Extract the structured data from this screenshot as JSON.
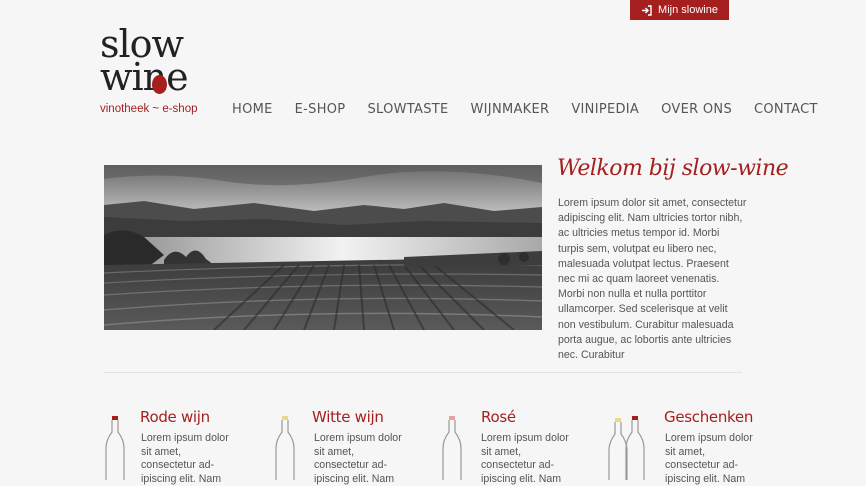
{
  "top_button": {
    "label": "Mijn slowine",
    "icon": "sign-in-icon",
    "color": "#a51f1f"
  },
  "logo": {
    "line1": "slow",
    "line2": "wine",
    "tagline": "vinotheek ~ e-shop"
  },
  "nav": {
    "items": [
      {
        "label": "HOME"
      },
      {
        "label": "E-SHOP"
      },
      {
        "label": "SLOWTASTE"
      },
      {
        "label": "WIJNMAKER"
      },
      {
        "label": "VINIPEDIA"
      },
      {
        "label": "OVER ONS"
      },
      {
        "label": "CONTACT"
      }
    ]
  },
  "welcome": {
    "title": "Welkom bij slow-wine",
    "body": "Lorem ipsum dolor sit amet, consectetur adipiscing elit. Nam ultricies tortor nibh, ac ultricies metus tempor id. Morbi turpis sem, volutpat eu libero nec, malesuada volutpat lectus. Praesent nec mi ac quam laoreet venenatis. Morbi non nulla et nulla porttitor ullamcorper. Sed scelerisque at velit non vestibulum. Curabitur malesuada porta augue, ac lobortis ante ultricies nec. Curabitur"
  },
  "categories": [
    {
      "title": "Rode wijn",
      "text": "Lorem ipsum dolor sit amet, consectetur ad-ipiscing elit. Nam",
      "icon": "red-wine-bottle-icon"
    },
    {
      "title": "Witte wijn",
      "text": "Lorem ipsum dolor sit amet, consectetur ad-ipiscing elit. Nam",
      "icon": "white-wine-bottle-icon"
    },
    {
      "title": "Rosé",
      "text": "Lorem ipsum dolor sit amet, consectetur ad-ipiscing elit. Nam",
      "icon": "rose-wine-bottle-icon"
    },
    {
      "title": "Geschenken",
      "text": "Lorem ipsum dolor sit amet, consectetur ad-ipiscing elit. Nam",
      "icon": "gift-bottles-icon"
    }
  ],
  "colors": {
    "accent": "#a51f1f",
    "background": "#f6f6f6",
    "text": "#555555"
  }
}
